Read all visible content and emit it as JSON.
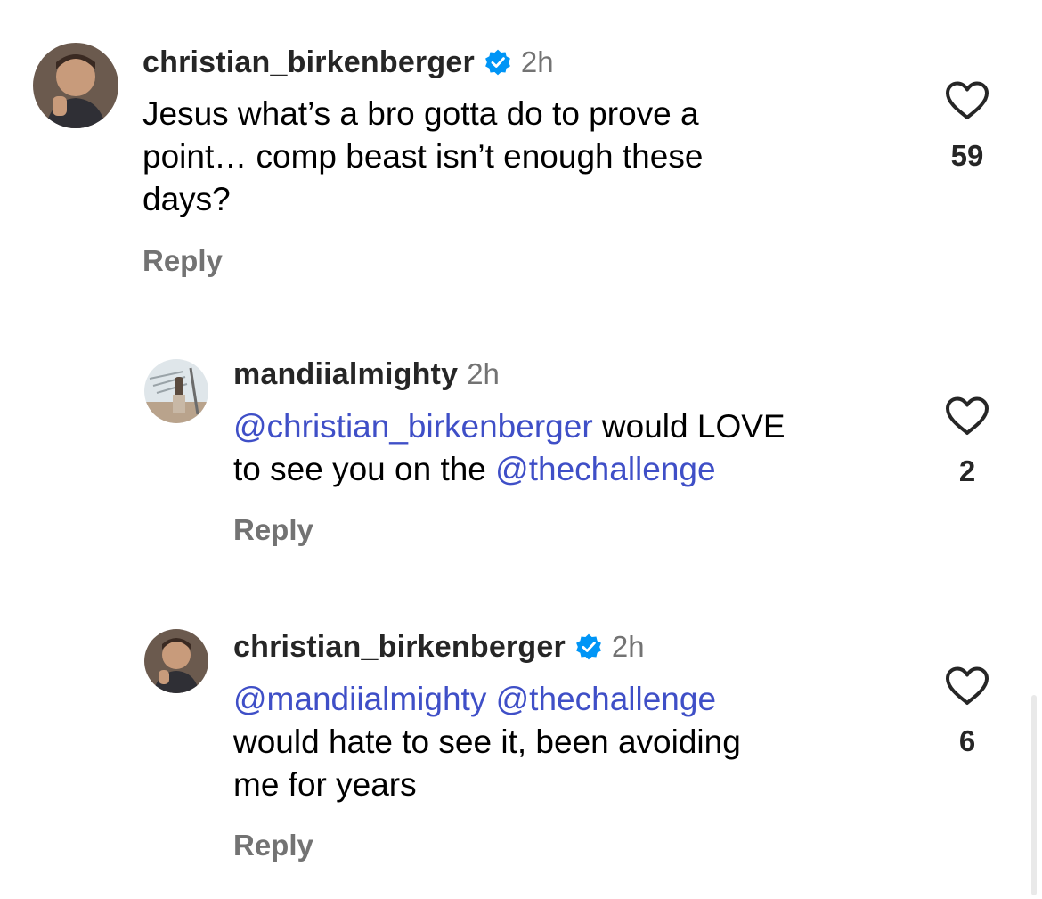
{
  "comments": [
    {
      "username": "christian_birkenberger",
      "verified": true,
      "time": "2h",
      "lines": [
        [
          {
            "text": "Jesus what’s a bro gotta do to prove a",
            "mention": false
          }
        ],
        [
          {
            "text": "point… comp beast isn’t enough these",
            "mention": false
          }
        ],
        [
          {
            "text": "days?",
            "mention": false
          }
        ]
      ],
      "reply_label": "Reply",
      "likes": "59"
    },
    {
      "username": "mandiialmighty",
      "verified": false,
      "time": "2h",
      "lines": [
        [
          {
            "text": "@christian_birkenberger",
            "mention": true
          },
          {
            "text": " would LOVE",
            "mention": false
          }
        ],
        [
          {
            "text": "to see you on the ",
            "mention": false
          },
          {
            "text": "@thechallenge",
            "mention": true
          }
        ]
      ],
      "reply_label": "Reply",
      "likes": "2"
    },
    {
      "username": "christian_birkenberger",
      "verified": true,
      "time": "2h",
      "lines": [
        [
          {
            "text": "@mandiialmighty",
            "mention": true
          },
          {
            "text": " ",
            "mention": false
          },
          {
            "text": "@thechallenge",
            "mention": true
          }
        ],
        [
          {
            "text": "would hate to see it, been avoiding",
            "mention": false
          }
        ],
        [
          {
            "text": "me for years",
            "mention": false
          }
        ]
      ],
      "reply_label": "Reply",
      "likes": "6"
    }
  ],
  "colors": {
    "mention": "#3f4fc7",
    "verified_badge": "#0095f6",
    "secondary_text": "#737373"
  },
  "icons": {
    "like": "heart-outline-icon",
    "verified": "verified-badge-icon"
  }
}
